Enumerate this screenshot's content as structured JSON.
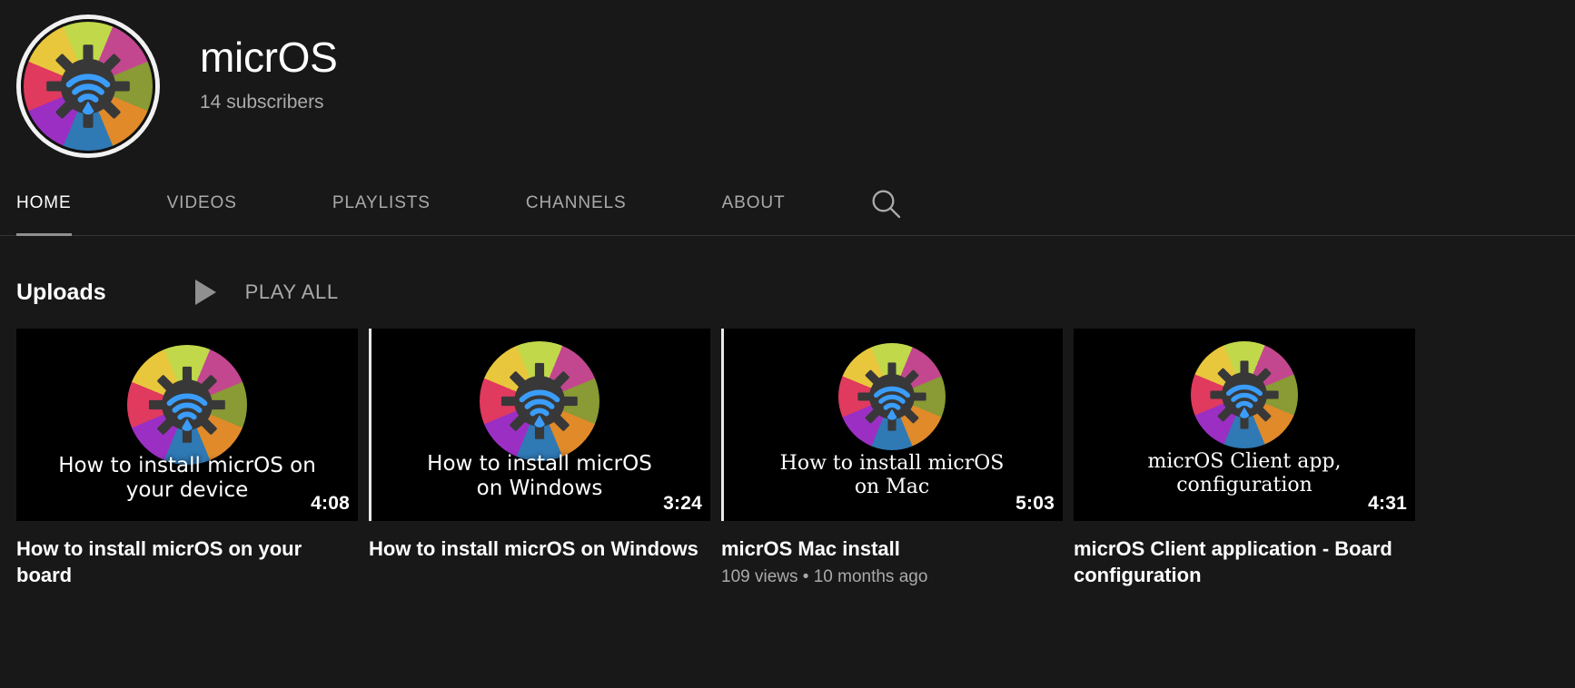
{
  "channel": {
    "name": "micrOS",
    "subscribers": "14 subscribers",
    "avatar_icon": "micros-gear-wifi-logo"
  },
  "tabs": [
    {
      "label": "HOME",
      "active": true
    },
    {
      "label": "VIDEOS",
      "active": false
    },
    {
      "label": "PLAYLISTS",
      "active": false
    },
    {
      "label": "CHANNELS",
      "active": false
    },
    {
      "label": "ABOUT",
      "active": false
    }
  ],
  "search": {
    "icon": "search-icon"
  },
  "shelf": {
    "title": "Uploads",
    "play_all_label": "PLAY ALL",
    "play_icon": "play-triangle-icon"
  },
  "videos": [
    {
      "title": "How to install micrOS on your board",
      "thumb_text": "How to install micrOS on\nyour device",
      "thumb_font": "sans",
      "duration": "4:08",
      "meta": "",
      "progress": false
    },
    {
      "title": "How to install micrOS on Windows",
      "thumb_text": "How to install micrOS\non Windows",
      "thumb_font": "sans",
      "duration": "3:24",
      "meta": "",
      "progress": true
    },
    {
      "title": "micrOS Mac install",
      "thumb_text": "How to install micrOS\non Mac",
      "thumb_font": "serif",
      "duration": "5:03",
      "meta": "109 views • 10 months ago",
      "progress": true
    },
    {
      "title": "micrOS Client application - Board configuration",
      "thumb_text": "micrOS Client app,\nconfiguration",
      "thumb_font": "serif",
      "duration": "4:31",
      "meta": "",
      "progress": false
    }
  ],
  "colors": {
    "background": "#181818",
    "text_primary": "#ffffff",
    "text_secondary": "#aaaaaa",
    "divider": "#333333",
    "active_underline": "#909090",
    "logo_wifi": "#3b9dfa",
    "logo_gear": "#383838",
    "logo_segments": [
      "#c0d84a",
      "#c2478f",
      "#8a9a34",
      "#e08a2a",
      "#2f79b5",
      "#9b2fc4",
      "#e03a5e",
      "#e8c73c"
    ]
  }
}
